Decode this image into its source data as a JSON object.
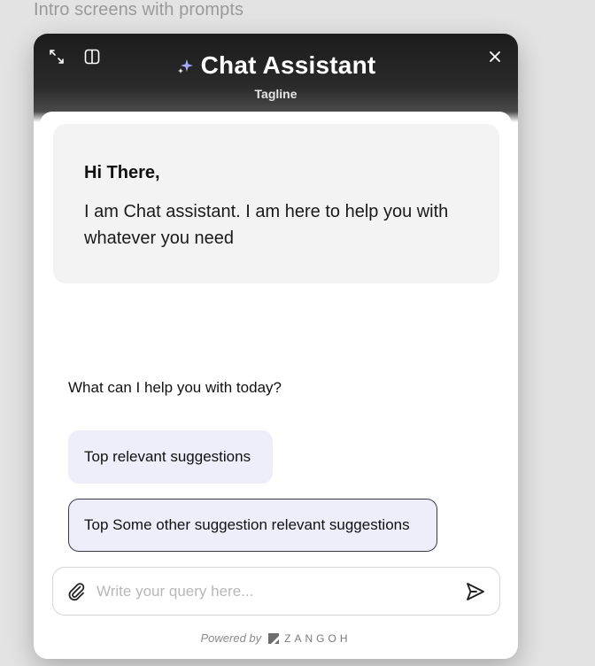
{
  "frame_label": "Intro screens with prompts",
  "header": {
    "title": "Chat Assistant",
    "tagline": "Tagline"
  },
  "greeting": {
    "title": "Hi There,",
    "body": "I am Chat assistant. I am here to help you with whatever you need"
  },
  "prompt_question": "What can I help you with today?",
  "suggestions": [
    {
      "label": "Top relevant suggestions"
    },
    {
      "label": "Top Some other suggestion relevant suggestions"
    }
  ],
  "composer": {
    "placeholder": "Write your query here...",
    "value": ""
  },
  "footer": {
    "powered_by": "Powered by",
    "brand": "ZANGOH"
  },
  "icons": {
    "expand": "expand-icon",
    "split": "split-view-icon",
    "close": "close-icon",
    "sparkle": "sparkle-icon",
    "attach": "paperclip-icon",
    "send": "send-icon",
    "brand": "brand-logo-icon"
  },
  "colors": {
    "header_dark": "#1c1c1c",
    "chip_bg": "#eeeefb",
    "greeting_bg": "#f3f3f3",
    "sparkle": "#a7a8ff"
  }
}
